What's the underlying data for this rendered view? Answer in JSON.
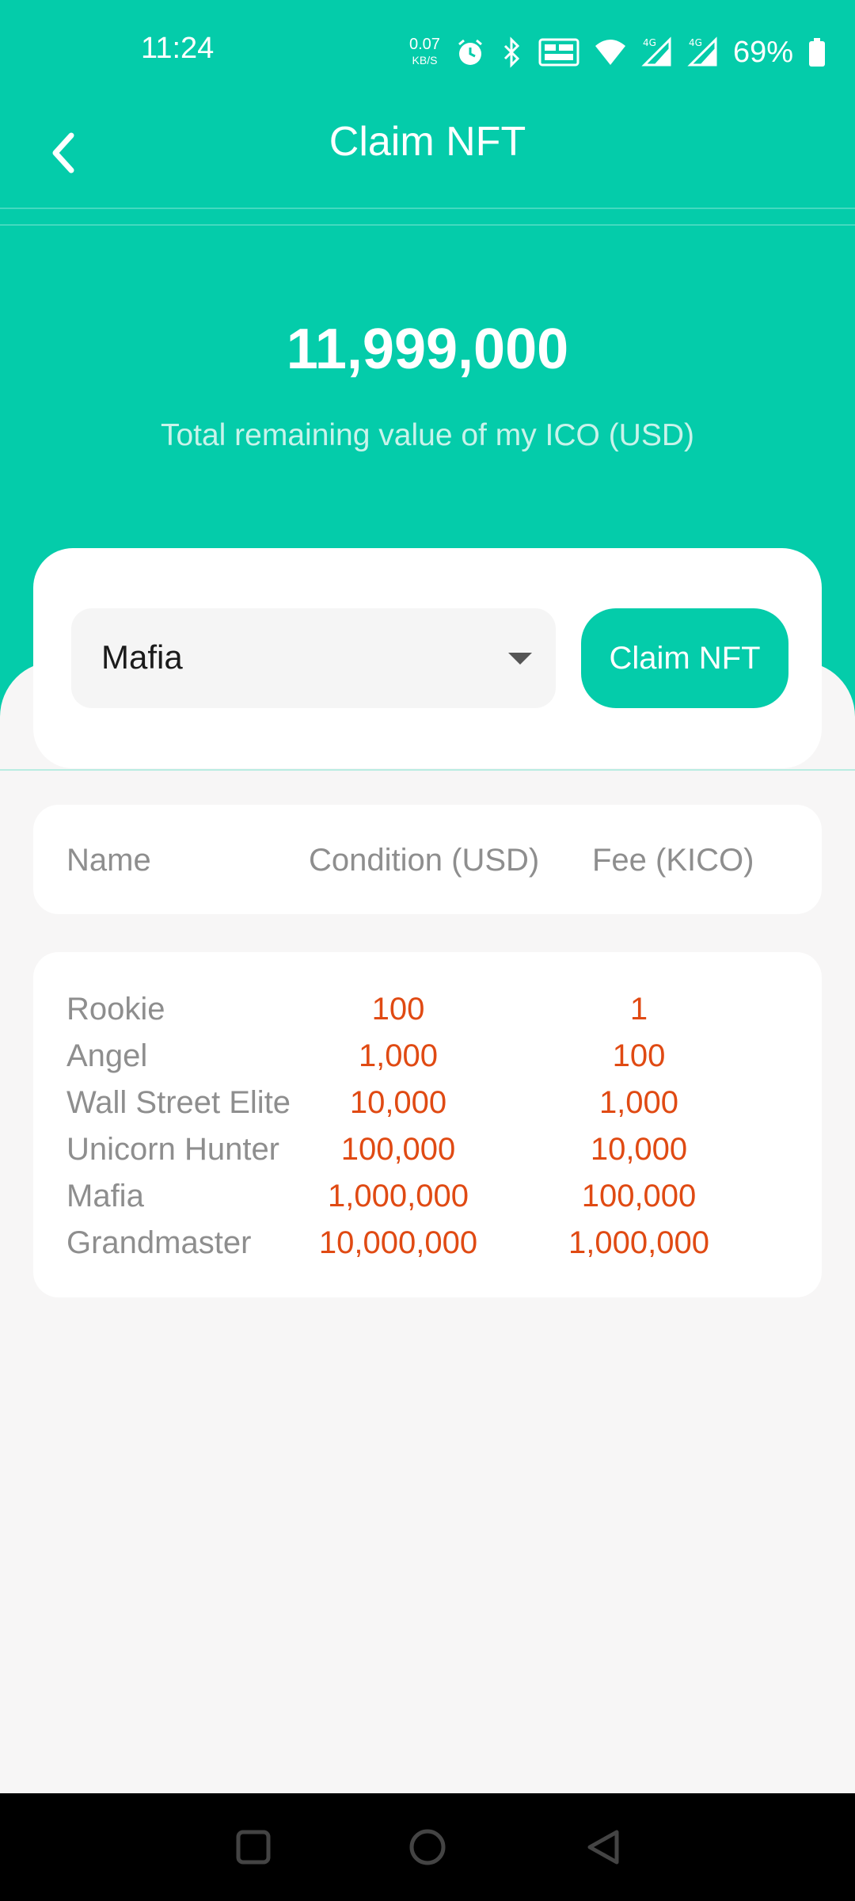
{
  "status_bar": {
    "time": "11:24",
    "net_speed_value": "0.07",
    "net_speed_unit": "KB/S",
    "battery_percent": "69%",
    "icons": [
      "alarm-icon",
      "bluetooth-icon",
      "volte-icon",
      "wifi-icon",
      "signal-4g-icon",
      "signal-4g-icon",
      "battery-icon"
    ]
  },
  "app_bar": {
    "title": "Claim NFT",
    "back_icon": "chevron-left-icon"
  },
  "summary": {
    "total_value": "11,999,000",
    "caption": "Total remaining value of my ICO (USD)"
  },
  "claim": {
    "selected_tier": "Mafia",
    "button_label": "Claim NFT"
  },
  "table": {
    "headers": [
      "Name",
      "Condition (USD)",
      "Fee (KICO)"
    ],
    "rows": [
      {
        "name": "Rookie",
        "condition": "100",
        "fee": "1"
      },
      {
        "name": "Angel",
        "condition": "1,000",
        "fee": "100"
      },
      {
        "name": "Wall Street Elite",
        "condition": "10,000",
        "fee": "1,000"
      },
      {
        "name": "Unicorn Hunter",
        "condition": "100,000",
        "fee": "10,000"
      },
      {
        "name": "Mafia",
        "condition": "1,000,000",
        "fee": "100,000"
      },
      {
        "name": "Grandmaster",
        "condition": "10,000,000",
        "fee": "1,000,000"
      }
    ]
  },
  "nav_bar": {
    "icons": [
      "recents-square-icon",
      "home-circle-icon",
      "back-triangle-icon"
    ]
  },
  "colors": {
    "brand_green": "#04ccaa",
    "value_orange": "#e04a13",
    "muted_text": "#8e8e8e",
    "background": "#f7f6f6"
  }
}
